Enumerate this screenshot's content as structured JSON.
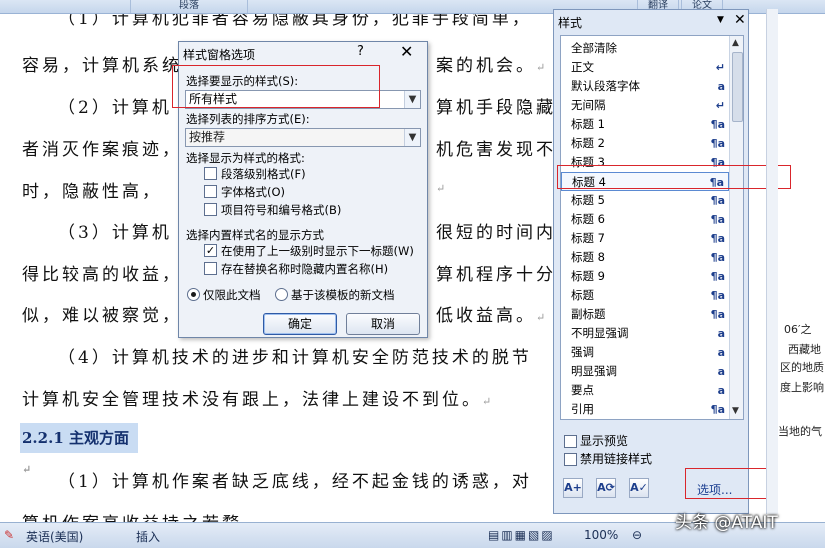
{
  "ribbon": {
    "tabs": [
      "段落",
      "翻译",
      "论文"
    ]
  },
  "document": {
    "lines": [
      "（1）计算机犯罪者容易隐蔽其身份，犯罪手段简单，",
      "容易，计算机系统",
      "案的机会。",
      "（2）计算机",
      "算机手段隐藏",
      "者消灭作案痕迹，",
      "机危害发现不",
      "时，隐蔽性高，",
      "（3）计算机",
      "很短的时间内",
      "得比较高的收益，",
      "算机程序十分",
      "似，难以被察觉，",
      "低收益高。",
      "（4）计算机技术的进步和计算机安全防范技术的脱节",
      "计算机安全管理技术没有跟上，法律上建设不到位。",
      "（1）计算机作案者缺乏底线，经不起金钱的诱惑，对",
      "算机作案高收益持之若骛。"
    ],
    "heading": "2.2.1 主观方面",
    "right_fragments": [
      "06′之",
      "西藏地",
      "区的地质",
      "度上影响",
      "当地的气"
    ]
  },
  "dialog": {
    "title": "样式窗格选项",
    "help": "?",
    "close": "✕",
    "show_label": "选择要显示的样式(S):",
    "show_value": "所有样式",
    "sort_label": "选择列表的排序方式(E):",
    "sort_value": "按推荐",
    "format_label": "选择显示为样式的格式:",
    "format_options": [
      {
        "label": "段落级别格式(F)",
        "checked": false
      },
      {
        "label": "字体格式(O)",
        "checked": false
      },
      {
        "label": "项目符号和编号格式(B)",
        "checked": false
      }
    ],
    "builtin_label": "选择内置样式名的显示方式",
    "builtin_options": [
      {
        "label": "在使用了上一级别时显示下一标题(W)",
        "checked": true
      },
      {
        "label": "存在替换名称时隐藏内置名称(H)",
        "checked": false
      }
    ],
    "scope_options": [
      {
        "label": "仅限此文档",
        "selected": true
      },
      {
        "label": "基于该模板的新文档",
        "selected": false
      }
    ],
    "ok": "确定",
    "cancel": "取消"
  },
  "styles_pane": {
    "title": "样式",
    "items": [
      {
        "label": "全部清除",
        "marker": ""
      },
      {
        "label": "正文",
        "marker": "↵"
      },
      {
        "label": "默认段落字体",
        "marker": "a"
      },
      {
        "label": "无间隔",
        "marker": "↵"
      },
      {
        "label": "标题 1",
        "marker": "¶a"
      },
      {
        "label": "标题 2",
        "marker": "¶a"
      },
      {
        "label": "标题 3",
        "marker": "¶a"
      },
      {
        "label": "标题 4",
        "marker": "¶a"
      },
      {
        "label": "标题 5",
        "marker": "¶a"
      },
      {
        "label": "标题 6",
        "marker": "¶a"
      },
      {
        "label": "标题 7",
        "marker": "¶a"
      },
      {
        "label": "标题 8",
        "marker": "¶a"
      },
      {
        "label": "标题 9",
        "marker": "¶a"
      },
      {
        "label": "标题",
        "marker": "¶a"
      },
      {
        "label": "副标题",
        "marker": "¶a"
      },
      {
        "label": "不明显强调",
        "marker": "a"
      },
      {
        "label": "强调",
        "marker": "a"
      },
      {
        "label": "明显强调",
        "marker": "a"
      },
      {
        "label": "要点",
        "marker": "a"
      },
      {
        "label": "引用",
        "marker": "¶a"
      }
    ],
    "selected_index": 7,
    "show_preview": "显示预览",
    "disable_linked": "禁用链接样式",
    "options_link": "选项..."
  },
  "status_bar": {
    "language": "英语(美国)",
    "mode": "插入",
    "zoom": "100%"
  },
  "watermark": "头条 @ATAIT"
}
